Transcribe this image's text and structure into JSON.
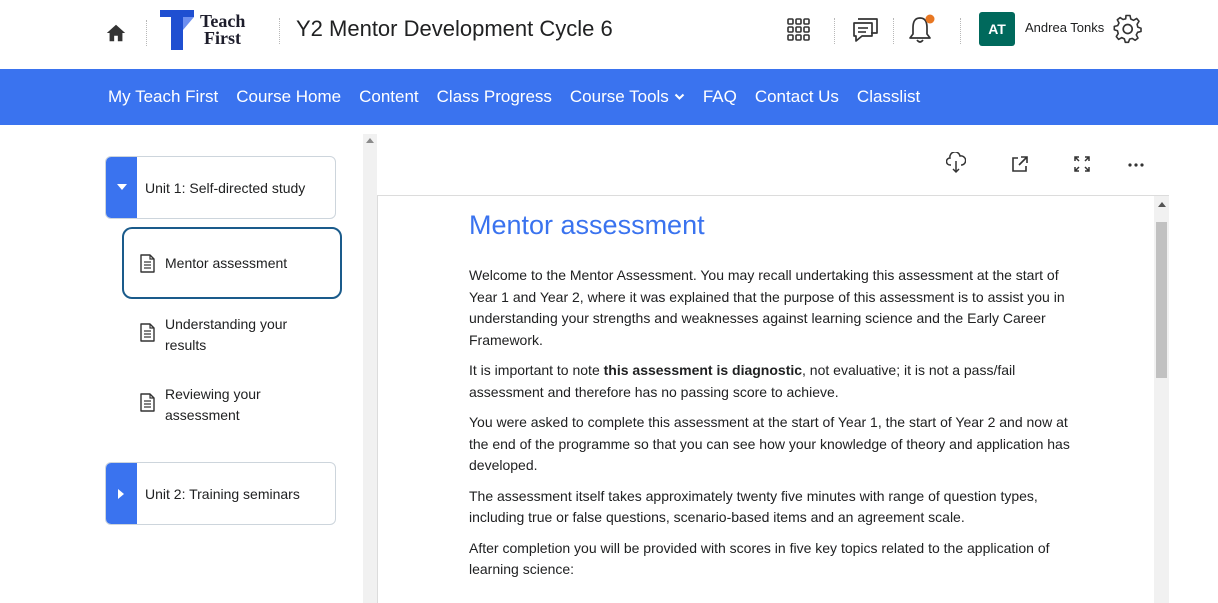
{
  "header": {
    "logo_line1": "Teach",
    "logo_line2": "First",
    "course_title": "Y2 Mentor Development Cycle 6",
    "user_initials": "AT",
    "user_name": "Andrea Tonks"
  },
  "nav": {
    "items": [
      "My Teach First",
      "Course Home",
      "Content",
      "Class Progress",
      "Course Tools",
      "FAQ",
      "Contact Us",
      "Classlist"
    ]
  },
  "sidebar": {
    "units": [
      {
        "label": "Unit 1: Self-directed study",
        "expanded": true
      },
      {
        "label": "Unit 2: Training seminars",
        "expanded": false
      }
    ],
    "topics": [
      {
        "label": "Mentor assessment",
        "selected": true
      },
      {
        "label_line1": "Understanding your",
        "label_line2": "results"
      },
      {
        "label_line1": "Reviewing your",
        "label_line2": "assessment"
      }
    ]
  },
  "content": {
    "title": "Mentor assessment",
    "p1": "Welcome to the Mentor Assessment. You may recall undertaking this assessment at the start of Year 1 and Year 2, where it was explained that the purpose of this assessment is to assist you in understanding your strengths and weaknesses against learning science and the Early Career Framework.",
    "p2_before": "It is important to note ",
    "p2_bold": "this assessment is diagnostic",
    "p2_after": ", not evaluative; it is not a pass/fail assessment and therefore has no passing score to achieve.",
    "p3": "You were asked to complete this assessment at the start of Year 1, the start of Year 2 and now at the end of the programme so that you can see how your knowledge of theory and application has developed.",
    "p4": "The assessment itself takes approximately twenty five minutes with range of question types, including true or false questions, scenario-based items and an agreement scale.",
    "p5": "After completion you will be provided with scores in five key topics related to the application of learning science:"
  },
  "colors": {
    "brand_blue": "#3a73ef",
    "avatar_green": "#00695c",
    "notification_dot": "#e87722",
    "selection_border": "#1a5b8b"
  },
  "icons": [
    "home-icon",
    "waffle-grid-icon",
    "chat-icon",
    "bell-icon",
    "gear-icon",
    "download-icon",
    "external-link-icon",
    "fullscreen-icon",
    "more-icon",
    "document-icon",
    "caret-down-icon",
    "caret-right-icon",
    "chevron-down-icon"
  ]
}
